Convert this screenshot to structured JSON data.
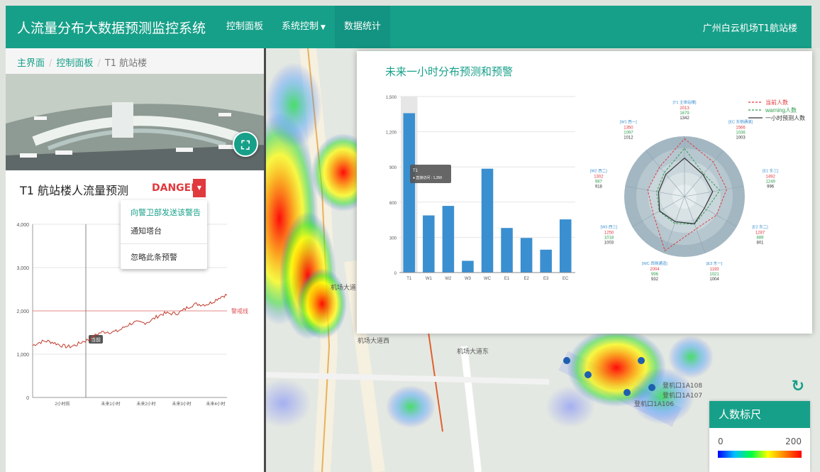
{
  "nav": {
    "brand": "人流量分布大数据预测监控系统",
    "items": [
      {
        "label": "控制面板",
        "caret": false,
        "active": false
      },
      {
        "label": "系统控制",
        "caret": true,
        "active": false
      },
      {
        "label": "数据统计",
        "caret": false,
        "active": true
      }
    ],
    "location": "广州白云机场T1航站楼"
  },
  "breadcrumb": {
    "home": "主界面",
    "panel": "控制面板",
    "current": "T1 航站楼"
  },
  "prediction": {
    "title": "T1 航站楼人流量预测",
    "status": "DANGER",
    "status_color": "#e0393e",
    "menu": [
      "向警卫部发送该警告",
      "通知塔台",
      "忽略此条预警"
    ]
  },
  "left_chart": {
    "type": "line",
    "x_labels": [
      "2小时前",
      "未来1小时",
      "未来2小时",
      "未来3小时",
      "未来4小时"
    ],
    "y_ticks": [
      0,
      1000,
      2000,
      3000,
      4000
    ],
    "ylim": [
      0,
      4000
    ],
    "threshold": 2000,
    "threshold_label": "警戒线",
    "marker_label": "当前",
    "line_color": "#c0392b"
  },
  "stats": {
    "title": "未来一小时分布预测和预警",
    "tooltip": {
      "name": "T1",
      "series": "直接访问",
      "value": "1,358"
    }
  },
  "chart_data": [
    {
      "type": "bar",
      "categories": [
        "T1",
        "W1",
        "W2",
        "W3",
        "WC",
        "E1",
        "E2",
        "E3",
        "EC"
      ],
      "values": [
        1358,
        487,
        568,
        100,
        885,
        380,
        295,
        195,
        453
      ],
      "ylim": [
        0,
        1500
      ],
      "y_ticks": [
        0,
        300,
        600,
        900,
        1200,
        1500
      ],
      "tick_labels": [
        "0",
        "300",
        "600",
        "900",
        "1,200",
        "1,500"
      ],
      "color": "#3a8fd0"
    },
    {
      "type": "radar",
      "legend": [
        "当前人数",
        "warning人数",
        "一小时预测人数"
      ],
      "legend_colors": [
        "#e0393e",
        "#2e9e4e",
        "#333333"
      ],
      "indicators": [
        {
          "name": "[T1 主体站楼]",
          "values": [
            "2013",
            "1679",
            "1342"
          ]
        },
        {
          "name": "[EC 东侧通道]",
          "values": [
            "1566",
            "1036",
            "1003"
          ]
        },
        {
          "name": "[E1 东三]",
          "values": [
            "1492",
            "1249",
            "996"
          ]
        },
        {
          "name": "[E2 东二]",
          "values": [
            "1287",
            "889",
            "801"
          ]
        },
        {
          "name": "[E3 东一]",
          "values": [
            "1193",
            "1021",
            "1004"
          ]
        },
        {
          "name": "[WC 西侧通道]",
          "values": [
            "2004",
            "996",
            "932"
          ]
        },
        {
          "name": "[W3 西三]",
          "values": [
            "1250",
            "1018",
            "1003"
          ]
        },
        {
          "name": "[W2 西二]",
          "values": [
            "1302",
            "987",
            "918"
          ]
        },
        {
          "name": "[W1 西一]",
          "values": [
            "1350",
            "1097",
            "1012"
          ]
        }
      ]
    }
  ],
  "map": {
    "labels": [
      "机场大道西",
      "机场大道东",
      "机场大道",
      "登机口1A108",
      "登机口1A107",
      "登机口1A106"
    ],
    "scale": {
      "title": "人数标尺",
      "min": "0",
      "max": "200"
    }
  }
}
